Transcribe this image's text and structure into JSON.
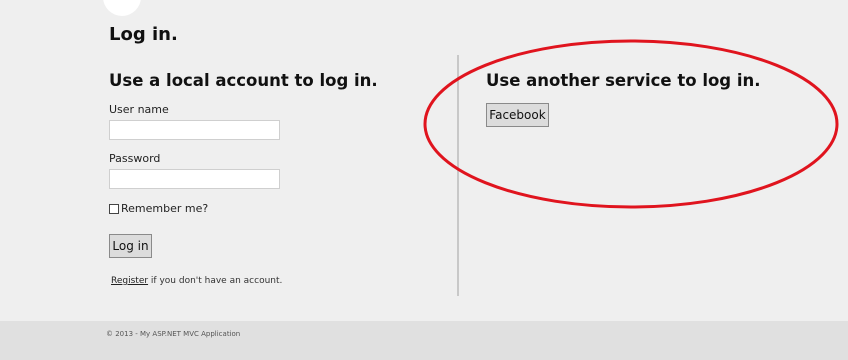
{
  "page": {
    "title": "Log in."
  },
  "local_login": {
    "heading": "Use a local account to log in.",
    "username_label": "User name",
    "username_value": "",
    "password_label": "Password",
    "password_value": "",
    "remember_label": "Remember me?",
    "remember_checked": false,
    "submit_label": "Log in",
    "register_link": "Register",
    "register_suffix": " if you don't have an account."
  },
  "external_login": {
    "heading": "Use another service to log in.",
    "facebook_label": "Facebook"
  },
  "footer": {
    "text": "© 2013 - My ASP.NET MVC Application"
  },
  "annotation": {
    "shape": "ellipse",
    "color": "#e0141e"
  }
}
